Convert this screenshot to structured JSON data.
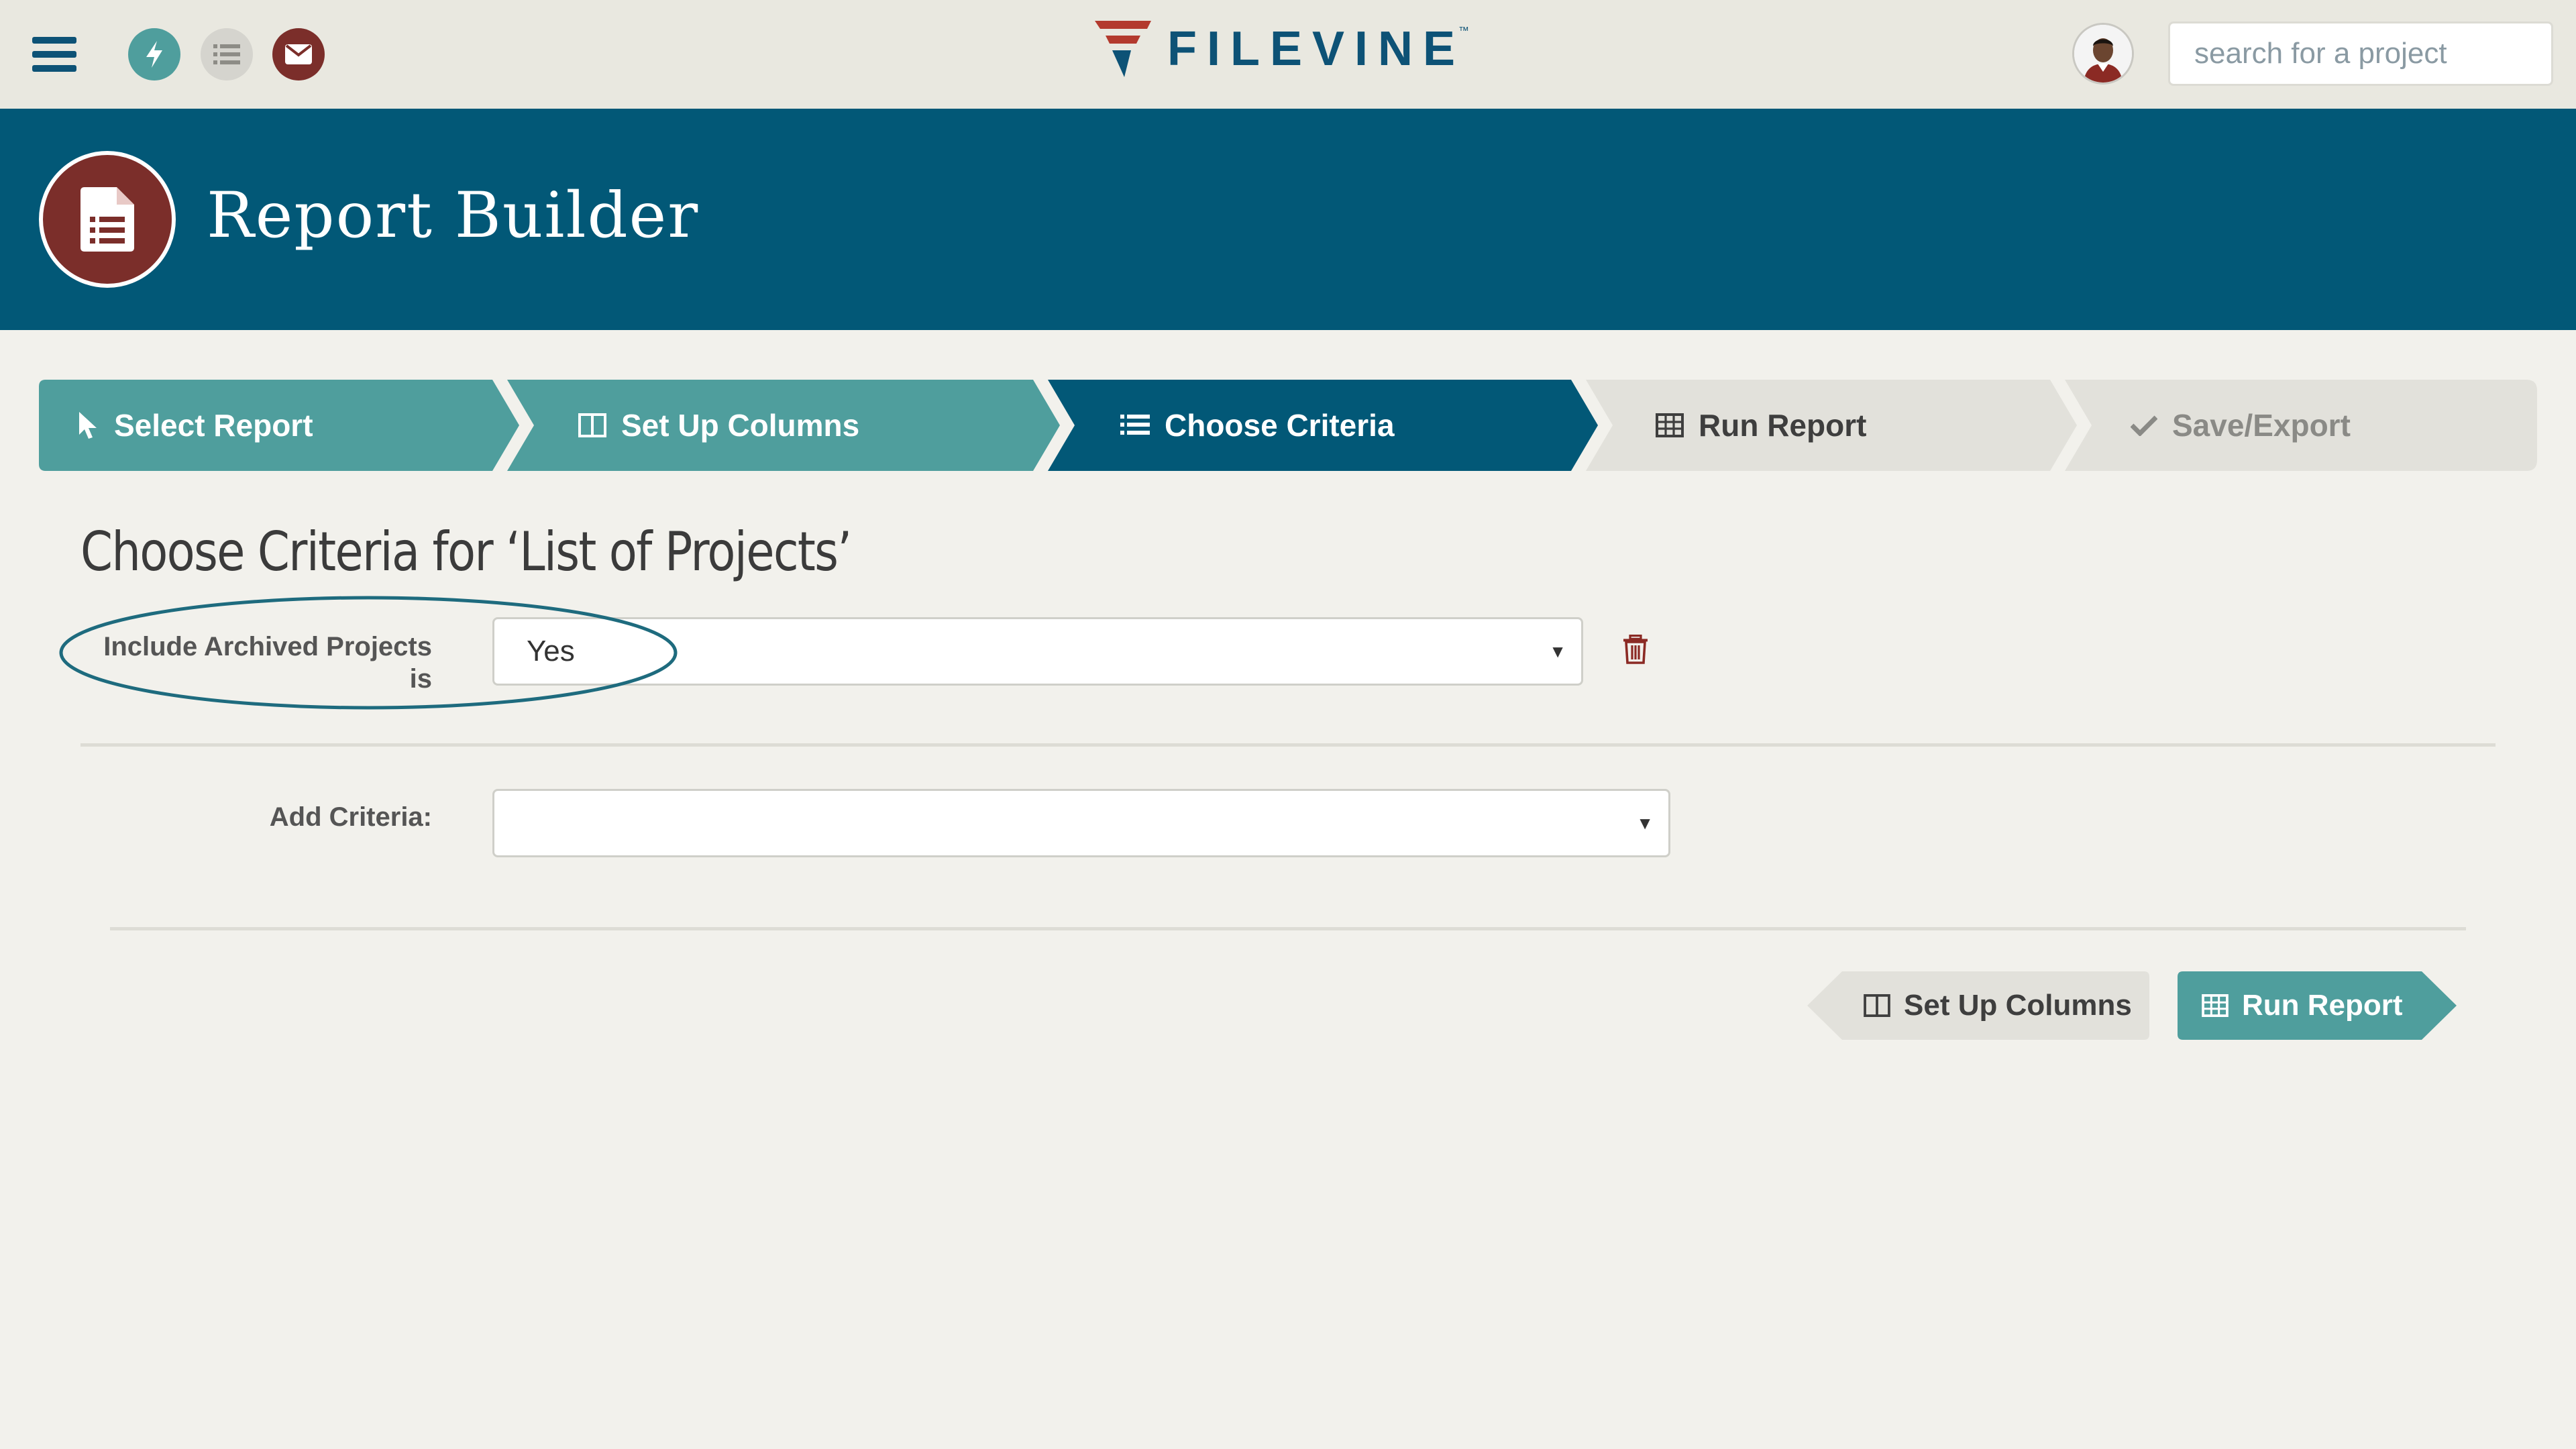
{
  "app": {
    "brand": "FILEVINE",
    "brand_tm": "™",
    "search_placeholder": "search for a project"
  },
  "topbar": {
    "icons": [
      "menu-icon",
      "bolt-icon",
      "list-icon",
      "mail-icon",
      "avatar"
    ]
  },
  "header": {
    "title": "Report Builder",
    "icon": "report-document-icon"
  },
  "steps": [
    {
      "label": "Select Report",
      "icon": "cursor-icon",
      "state": "completed"
    },
    {
      "label": "Set Up Columns",
      "icon": "columns-icon",
      "state": "completed"
    },
    {
      "label": "Choose Criteria",
      "icon": "list-icon",
      "state": "active"
    },
    {
      "label": "Run Report",
      "icon": "table-icon",
      "state": "pending"
    },
    {
      "label": "Save/Export",
      "icon": "check-icon",
      "state": "pending"
    }
  ],
  "main": {
    "title": "Choose Criteria for ‘List of Projects’",
    "criteria": [
      {
        "label": "Include Archived Projects is",
        "value": "Yes"
      }
    ],
    "add_criteria_label": "Add Criteria:",
    "add_criteria_value": ""
  },
  "buttons": {
    "prev_label": "Set Up Columns",
    "next_label": "Run Report"
  },
  "colors": {
    "navy": "#025877",
    "teal": "#4f9e9d",
    "maroon": "#7b2e2a",
    "background": "#f2f1ec"
  }
}
